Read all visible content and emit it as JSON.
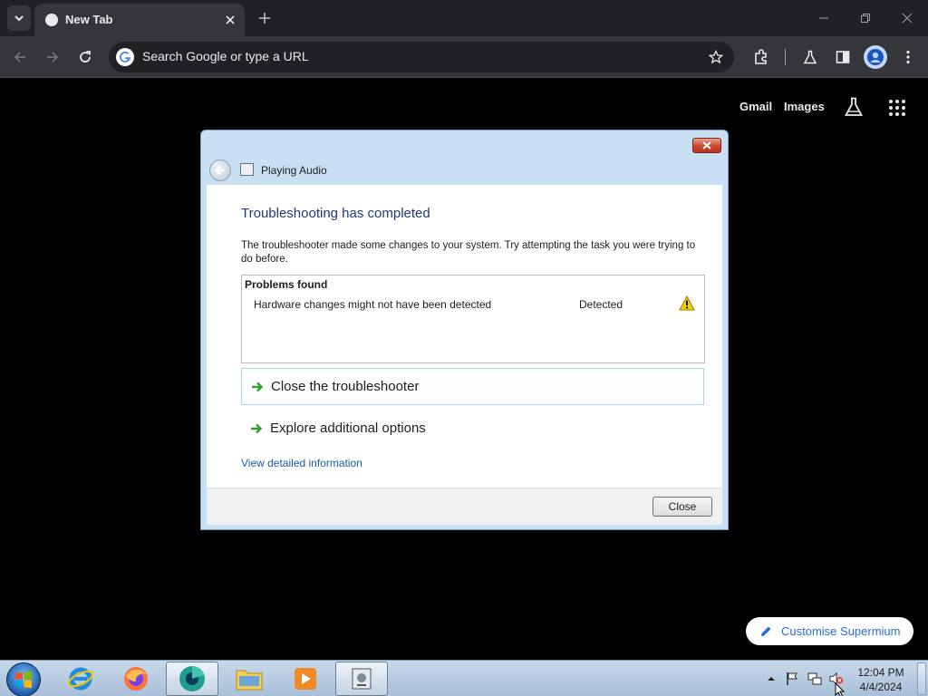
{
  "browser": {
    "tab": {
      "title": "New Tab"
    },
    "omnibox": {
      "placeholder": "Search Google or type a URL"
    },
    "ntp": {
      "gmail": "Gmail",
      "images": "Images",
      "customise": "Customise Supermium"
    }
  },
  "dialog": {
    "title": "Playing Audio",
    "heading": "Troubleshooting has completed",
    "description": "The troubleshooter made some changes to your system. Try attempting the task you were trying to do before.",
    "problems": {
      "header": "Problems found",
      "rows": [
        {
          "name": "Hardware changes might not have been detected",
          "status": "Detected",
          "icon": "warning-icon"
        }
      ]
    },
    "commands": {
      "close_troubleshooter": "Close the troubleshooter",
      "explore_options": "Explore additional options"
    },
    "details_link": "View detailed information",
    "close_button": "Close"
  },
  "taskbar": {
    "apps": [
      "internet-explorer",
      "firefox",
      "supermium",
      "file-explorer",
      "media-player",
      "troubleshooter"
    ],
    "clock": {
      "time": "12:04 PM",
      "date": "4/4/2024"
    }
  },
  "colors": {
    "accent_blue": "#1e3a78",
    "link_blue": "#1d5aa8",
    "browser_dark": "#35363a"
  }
}
